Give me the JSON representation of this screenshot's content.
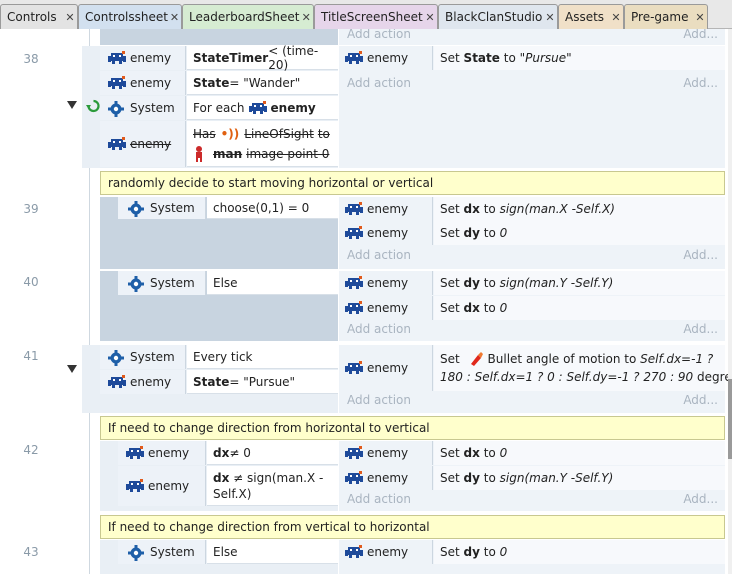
{
  "tabs": [
    {
      "label": "Controls",
      "color": "#e3e3e3"
    },
    {
      "label": "Controlssheet",
      "color": "#d2e0ef"
    },
    {
      "label": "LeaderboardSheet",
      "color": "#d6ecd2"
    },
    {
      "label": "TitleScreenSheet",
      "color": "#e6d5ea"
    },
    {
      "label": "BlackClanStudio",
      "color": "#dfe6ee"
    },
    {
      "label": "Assets",
      "color": "#f0e0c8"
    },
    {
      "label": "Pre-game",
      "color": "#eaddc0"
    }
  ],
  "common": {
    "add_action": "Add action",
    "add_short": "Add...",
    "enemy": "enemy",
    "system": "System",
    "set": "Set",
    "to": "to"
  },
  "event38": {
    "num": "38",
    "cond1_kw": "StateTimer",
    "cond1_rest": " < (time-20)",
    "cond2_kw": "State",
    "cond2_rest": " = \"Wander\"",
    "cond3_pre": "For each",
    "cond3_obj": "enemy",
    "cond4_has": "Has",
    "cond4_behavior": "LineOfSight",
    "cond4_to": "to",
    "cond4_obj": "man",
    "cond4_rest": "image point 0",
    "action1_var": "State",
    "action1_val": "\"Pursue\""
  },
  "event39": {
    "num": "39",
    "comment": "randomly decide to start moving horizontal or vertical",
    "cond": "choose(0,1) = 0",
    "a1_var": "dx",
    "a1_val": "sign(man.X -Self.X)",
    "a2_var": "dy",
    "a2_val": "0"
  },
  "event40": {
    "num": "40",
    "cond": "Else",
    "a1_var": "dy",
    "a1_val": "sign(man.Y -Self.Y)",
    "a2_var": "dx",
    "a2_val": "0"
  },
  "event41": {
    "num": "41",
    "cond1": "Every tick",
    "cond2_kw": "State",
    "cond2_rest": " = \"Pursue\"",
    "act_obj": "Bullet",
    "act_text1": "angle of motion to",
    "act_expr1": "Self.dx=-1 ?",
    "act_expr2": "180 : Self.dx=1 ? 0 : Self.dy=-1 ? 270 : 90",
    "act_unit": "degrees"
  },
  "event42": {
    "num": "42",
    "comment": "If need to change direction from horizontal to vertical",
    "cond1_kw": "dx",
    "cond1_rest": " ≠ 0",
    "cond2_kw": "dx",
    "cond2_rest1": " ≠ sign(man.X -",
    "cond2_rest2": "Self.X)",
    "a1_var": "dx",
    "a1_val": "0",
    "a2_var": "dy",
    "a2_val": "sign(man.Y -Self.Y)"
  },
  "event43": {
    "num": "43",
    "comment": "If need to change direction from vertical to horizontal",
    "cond": "Else",
    "a1_var": "dy",
    "a1_val": "0"
  }
}
